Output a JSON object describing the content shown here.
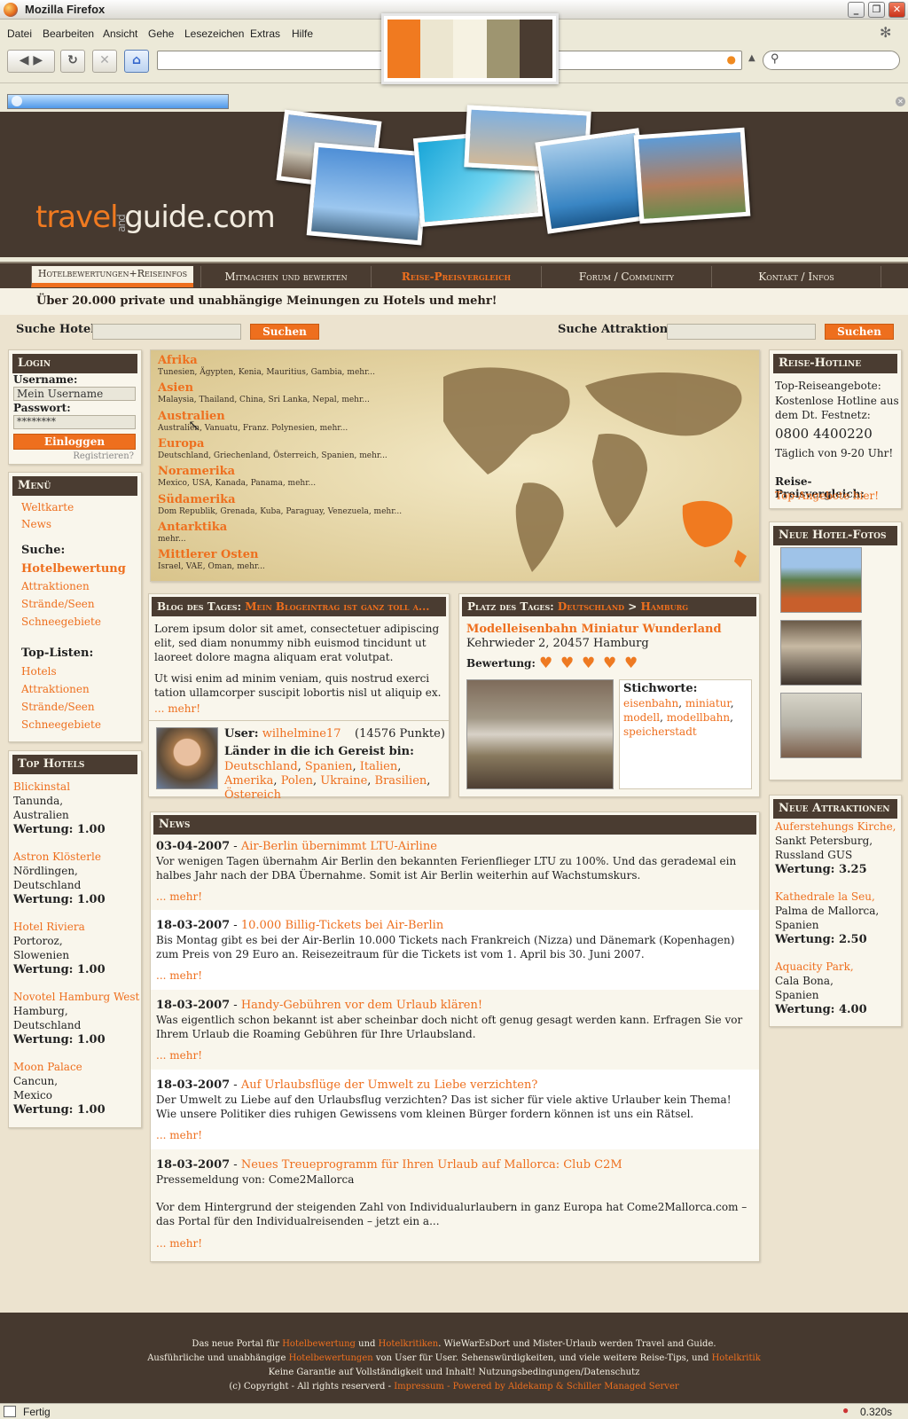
{
  "browser": {
    "title": "Mozilla Firefox",
    "menus": [
      "Datei",
      "Bearbeiten",
      "Ansicht",
      "Gehe",
      "Lesezeichen",
      "Extras",
      "Hilfe"
    ],
    "status": "Fertig",
    "time": "0.320s"
  },
  "swatches": [
    "#f07a20",
    "#ece6d0",
    "#f6f2e2",
    "#9e9570",
    "#4a3c31"
  ],
  "logo": {
    "travel": "travel",
    "and": "and",
    "guide": "guide.com"
  },
  "nav": [
    "Hotelbewertungen+Reiseinfos",
    "Mitmachen und bewerten",
    "Reise-Preisvergleich",
    "Forum / Community",
    "Kontakt / Infos"
  ],
  "tagline": "Über 20.000 private und unabhängige Meinungen zu Hotels und mehr!",
  "search": {
    "hotel_label": "Suche Hotel:",
    "attr_label": "Suche Attraktion:",
    "button": "Suchen"
  },
  "login": {
    "title": "Login",
    "user_label": "Username:",
    "user_value": "Mein Username",
    "pass_label": "Passwort:",
    "pass_value": "********",
    "button": "Einloggen",
    "register": "Registrieren?"
  },
  "menu": {
    "title": "Menü",
    "items": [
      "Weltkarte",
      "News"
    ],
    "search_title": "Suche:",
    "search_items": [
      "Hotelbewertung",
      "Attraktionen",
      "Strände/Seen",
      "Schneegebiete"
    ],
    "top_title": "Top-Listen:",
    "top_items": [
      "Hotels",
      "Attraktionen",
      "Strände/Seen",
      "Schneegebiete"
    ]
  },
  "top_hotels": {
    "title": "Top Hotels",
    "items": [
      {
        "name": "Blickinstal",
        "l1": "Tanunda,",
        "l2": "Australien",
        "rating": "Wertung: 1.00"
      },
      {
        "name": "Astron Klösterle",
        "l1": "Nördlingen,",
        "l2": "Deutschland",
        "rating": "Wertung: 1.00"
      },
      {
        "name": "Hotel Riviera",
        "l1": "Portoroz,",
        "l2": "Slowenien",
        "rating": "Wertung: 1.00"
      },
      {
        "name": "Novotel Hamburg West",
        "l1": "Hamburg,",
        "l2": "Deutschland",
        "rating": "Wertung: 1.00"
      },
      {
        "name": "Moon Palace",
        "l1": "Cancun,",
        "l2": "Mexico",
        "rating": "Wertung: 1.00"
      }
    ]
  },
  "regions": [
    {
      "name": "Afrika",
      "countries": "Tunesien, Ägypten, Kenia, Mauritius, Gambia, mehr..."
    },
    {
      "name": "Asien",
      "countries": "Malaysia, Thailand, China, Sri Lanka, Nepal, mehr..."
    },
    {
      "name": "Australien",
      "countries": "Australien, Vanuatu, Franz. Polynesien, mehr..."
    },
    {
      "name": "Europa",
      "countries": "Deutschland, Griechenland, Österreich,  Spanien, mehr..."
    },
    {
      "name": "Noramerika",
      "countries": "Mexico, USA, Kanada, Panama, mehr..."
    },
    {
      "name": "Südamerika",
      "countries": "Dom Republik, Grenada, Kuba, Paraguay, Venezuela, mehr..."
    },
    {
      "name": "Antarktika",
      "countries": "mehr..."
    },
    {
      "name": "Mittlerer Osten",
      "countries": "Israel, VAE, Oman, mehr..."
    }
  ],
  "blog": {
    "title": "Blog des Tages:",
    "link": "Mein Blogeintrag ist ganz toll a...",
    "p1": "Lorem ipsum dolor sit amet, consectetuer adipiscing elit, sed diam nonummy nibh euismod tincidunt ut laoreet dolore magna aliquam erat volutpat.",
    "p2": "Ut wisi enim ad minim veniam, quis nostrud exerci tation ullamcorper suscipit lobortis nisl ut aliquip ex.",
    "more": "... mehr!",
    "user_label": "User:",
    "user": "wilhelmine17",
    "points": "(14576 Punkte)",
    "countries_label": "Länder in die ich Gereist bin:",
    "countries": [
      "Deutschland",
      "Spanien",
      "Italien",
      "Amerika",
      "Polen",
      "Ukraine",
      "Brasilien",
      "Östereich"
    ]
  },
  "place": {
    "title": "Platz des Tages:",
    "country": "Deutschland",
    "sep": ">",
    "city": "Hamburg",
    "name": "Modelleisenbahn Miniatur Wunderland",
    "address": "Kehrwieder 2, 20457 Hamburg",
    "rating_label": "Bewertung:",
    "rating": 5,
    "tags_label": "Stichworte:",
    "tags": [
      "eisenbahn",
      "miniatur",
      "modell",
      "modellbahn",
      "speicherstadt"
    ]
  },
  "news": {
    "title": "News",
    "more": "... mehr!",
    "items": [
      {
        "date": "03-04-2007",
        "title": "Air-Berlin übernimmt LTU-Airline",
        "text": "Vor wenigen Tagen übernahm Air Berlin den bekannten Ferienflieger LTU zu 100%. Und das geradeмal ein halbes Jahr nach der DBA Übernahme. Somit ist Air Berlin weiterhin auf Wachstumskurs."
      },
      {
        "date": "18-03-2007",
        "title": "10.000 Billig-Tickets bei Air-Berlin",
        "text": "Bis Montag gibt es bei der Air-Berlin 10.000 Tickets nach Frankreich (Nizza) und Dänemark (Kopenhagen) zum Preis von 29 Euro an. Reisezeitraum für die Tickets ist vom 1. April bis 30. Juni 2007."
      },
      {
        "date": "18-03-2007",
        "title": "Handy-Gebühren vor dem Urlaub klären!",
        "text": "Was eigentlich schon bekannt ist aber scheinbar doch nicht oft genug gesagt werden kann. Erfragen Sie vor Ihrem Urlaub die Roaming Gebühren für Ihre Urlaubsland."
      },
      {
        "date": "18-03-2007",
        "title": "Auf Urlaubsflüge der Umwelt zu Liebe verzichten?",
        "text": "Der Umwelt zu Liebe auf den Urlaubsflug verzichten? Das ist sicher für viele aktive Urlauber kein Thema! Wie unsere Politiker dies ruhigen Gewissens vom kleinen Bürger fordern können ist uns ein Rätsel."
      },
      {
        "date": "18-03-2007",
        "title": "Neues Treueprogramm für Ihren Urlaub auf Mallorca: Club C2M",
        "text": "Pressemeldung von: Come2Mallorca",
        "text2": "Vor dem Hintergrund der steigenden Zahl von Individualurlaubern in ganz Europa hat Come2Mallorca.com – das Portal für den Individualreisenden – jetzt ein a..."
      }
    ]
  },
  "hotline": {
    "title": "Reise-Hotline",
    "l1": "Top-Reiseangebote:",
    "l2": "Kostenlose Hotline aus dem Dt. Festnetz:",
    "phone": "0800 4400220",
    "hours": "Täglich von 9-20 Uhr!",
    "cmp": "Reise-Preisvergleich:",
    "cmp_link": "Top-Angebote hier!"
  },
  "hotel_photos": {
    "title": "Neue Hotel-Fotos"
  },
  "attractions": {
    "title": "Neue Attraktionen",
    "items": [
      {
        "name": "Auferstehungs Kirche,",
        "l1": "Sankt Petersburg,",
        "l2": "Russland GUS",
        "rating": "Wertung: 3.25"
      },
      {
        "name": "Kathedrale la Seu,",
        "l1": "Palma de Mallorca,",
        "l2": "Spanien",
        "rating": "Wertung: 2.50"
      },
      {
        "name": "Aquacity Park,",
        "l1": "Cala Bona,",
        "l2": "Spanien",
        "rating": "Wertung: 4.00"
      }
    ]
  },
  "footer": {
    "l1a": "Das neue Portal für",
    "l1b": "Hotelbewertung",
    "l1c": "und",
    "l1d": "Hotelkritiken",
    "l1e": ". WieWarEsDort und Mister-Urlaub werden Travel and Guide.",
    "l2a": "Ausführliche und unabhängige",
    "l2b": "Hotelbewertungen",
    "l2c": "von User für User. Sehenswürdigkeiten, und viele weitere Reise-Tips, und",
    "l2d": "Hotelkritik",
    "l3": "Keine Garantie auf Vollständigkeit und Inhalt! Nutzungsbedingungen/Datenschutz",
    "l4a": "(c) Copyright - All rights reserverd -",
    "l4b": "Impressum - Powered by Aldekamp & Schiller",
    "l4c": "Managed Server"
  }
}
